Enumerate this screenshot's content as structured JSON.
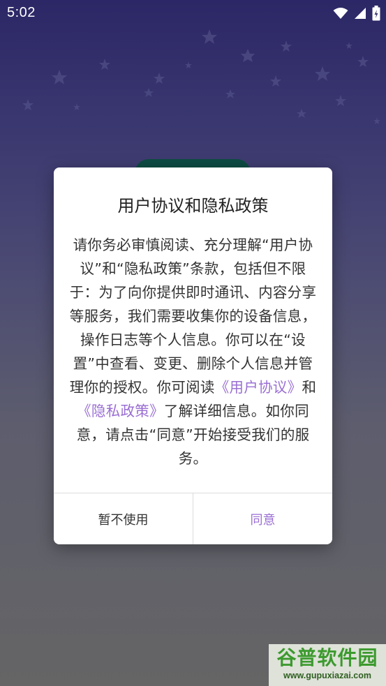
{
  "status_bar": {
    "time": "5:02",
    "icons": [
      "wifi-icon",
      "signal-icon",
      "battery-icon"
    ]
  },
  "dialog": {
    "title": "用户协议和隐私政策",
    "body": {
      "part1": "请你务必审慎阅读、充分理解“用户协议”和“隐私政策”条款，包括但不限于：为了向你提供即时通讯、内容分享等服务，我们需要收集你的设备信息，操作日志等个人信息。你可以在“设置”中查看、变更、删除个人信息并管理你的授权。你可阅读",
      "user_agreement_link": "《用户协议》",
      "conjunction": "和",
      "privacy_policy_link": "《隐私政策》",
      "part2": "了解详细信息。如你同意，请点击“同意”开始接受我们的服务。"
    },
    "decline_label": "暂不使用",
    "accept_label": "同意"
  },
  "watermark": {
    "brand": "谷普软件园",
    "url": "www.gupuxiazai.com"
  },
  "colors": {
    "accent": "#9a6fd3",
    "text_primary": "#222222",
    "text_body": "#333333",
    "overlay_top": "#2c2766",
    "overlay_bottom": "#656565"
  }
}
